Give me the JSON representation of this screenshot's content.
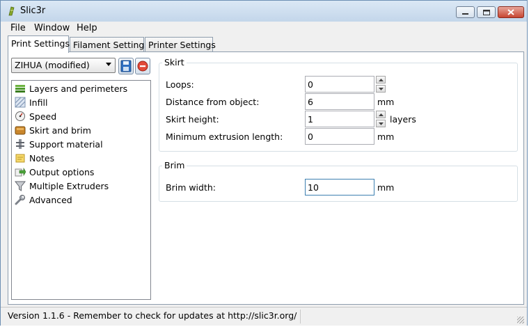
{
  "window": {
    "title": "Slic3r"
  },
  "menu": {
    "file": "File",
    "window": "Window",
    "help": "Help"
  },
  "tabs": [
    {
      "label": "Print Settings",
      "active": true
    },
    {
      "label": "Filament Settings",
      "active": false
    },
    {
      "label": "Printer Settings",
      "active": false
    }
  ],
  "preset": {
    "selected": "ZIHUA (modified)"
  },
  "tree": [
    {
      "label": "Layers and perimeters",
      "icon": "layers-icon"
    },
    {
      "label": "Infill",
      "icon": "infill-icon"
    },
    {
      "label": "Speed",
      "icon": "speed-icon"
    },
    {
      "label": "Skirt and brim",
      "icon": "skirt-icon",
      "selected": true
    },
    {
      "label": "Support material",
      "icon": "support-icon"
    },
    {
      "label": "Notes",
      "icon": "notes-icon"
    },
    {
      "label": "Output options",
      "icon": "output-icon"
    },
    {
      "label": "Multiple Extruders",
      "icon": "funnel-icon"
    },
    {
      "label": "Advanced",
      "icon": "wrench-icon"
    }
  ],
  "skirt": {
    "title": "Skirt",
    "loops": {
      "label": "Loops:",
      "value": "0"
    },
    "distance": {
      "label": "Distance from object:",
      "value": "6",
      "unit": "mm"
    },
    "height": {
      "label": "Skirt height:",
      "value": "1",
      "unit": "layers"
    },
    "min_extrusion": {
      "label": "Minimum extrusion length:",
      "value": "0",
      "unit": "mm"
    }
  },
  "brim": {
    "title": "Brim",
    "width": {
      "label": "Brim width:",
      "value": "10",
      "unit": "mm"
    }
  },
  "status": {
    "text": "Version 1.1.6 - Remember to check for updates at http://slic3r.org/"
  },
  "colors": {
    "titlebar": "#c3d6ea",
    "close_button": "#c74632",
    "focus_border": "#3c7fb1",
    "selection": "#3399ff"
  }
}
